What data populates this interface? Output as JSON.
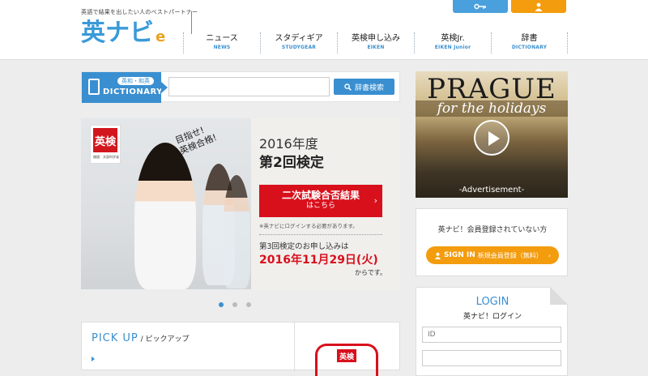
{
  "header": {
    "tagline": "英語で結果を出したい人のベストパートナー",
    "logo_text": "英ナビ",
    "logo_mark": "e",
    "key_button": "",
    "user_button": ""
  },
  "nav": [
    {
      "jp": "ニュース",
      "en": "NEWS"
    },
    {
      "jp": "スタディギア",
      "en": "STUDYGEAR"
    },
    {
      "jp": "英検申し込み",
      "en": "EIKEN"
    },
    {
      "jp": "英検Jr.",
      "en": "EIKEN Junior"
    },
    {
      "jp": "辞書",
      "en": "DICTIONARY"
    }
  ],
  "dictionary": {
    "badge_small": "英和・和英",
    "badge_big": "DICTIONARY",
    "input_value": "",
    "search_label": "辞書検索"
  },
  "banner": {
    "logo": "英検",
    "logo_sub": "後援：文部科学省",
    "catch1": "目指せ!",
    "catch2": "英検合格!",
    "year": "2016年度",
    "title": "第2回検定",
    "red_line1": "二次試験合否結果",
    "red_line2": "はこちら",
    "note": "※英ナビにログインする必要があります。",
    "next": "第3回検定のお申し込みは",
    "date": "2016年11月29日(火)",
    "from": "からです。"
  },
  "carousel": {
    "active": 1,
    "count": 3
  },
  "pickup": {
    "title": "PICK UP",
    "subtitle": " / ピックアップ",
    "thumb_logo": "英検"
  },
  "ad": {
    "title": "PRAGUE",
    "subtitle": "for the holidays",
    "label": "-Advertisement-"
  },
  "member": {
    "text": "英ナビ！会員登録されていない方",
    "btn_main": "SIGN IN",
    "btn_sub": "新規会員登録（無料）",
    "btn_arrow": "›"
  },
  "login": {
    "title": "LOGIN",
    "subtitle": "英ナビ！ログイン",
    "id_placeholder": "ID",
    "pw_placeholder": ""
  },
  "colors": {
    "brand_blue": "#3a8fd0",
    "accent_orange": "#f39c0e",
    "eiken_red": "#d8101c"
  }
}
